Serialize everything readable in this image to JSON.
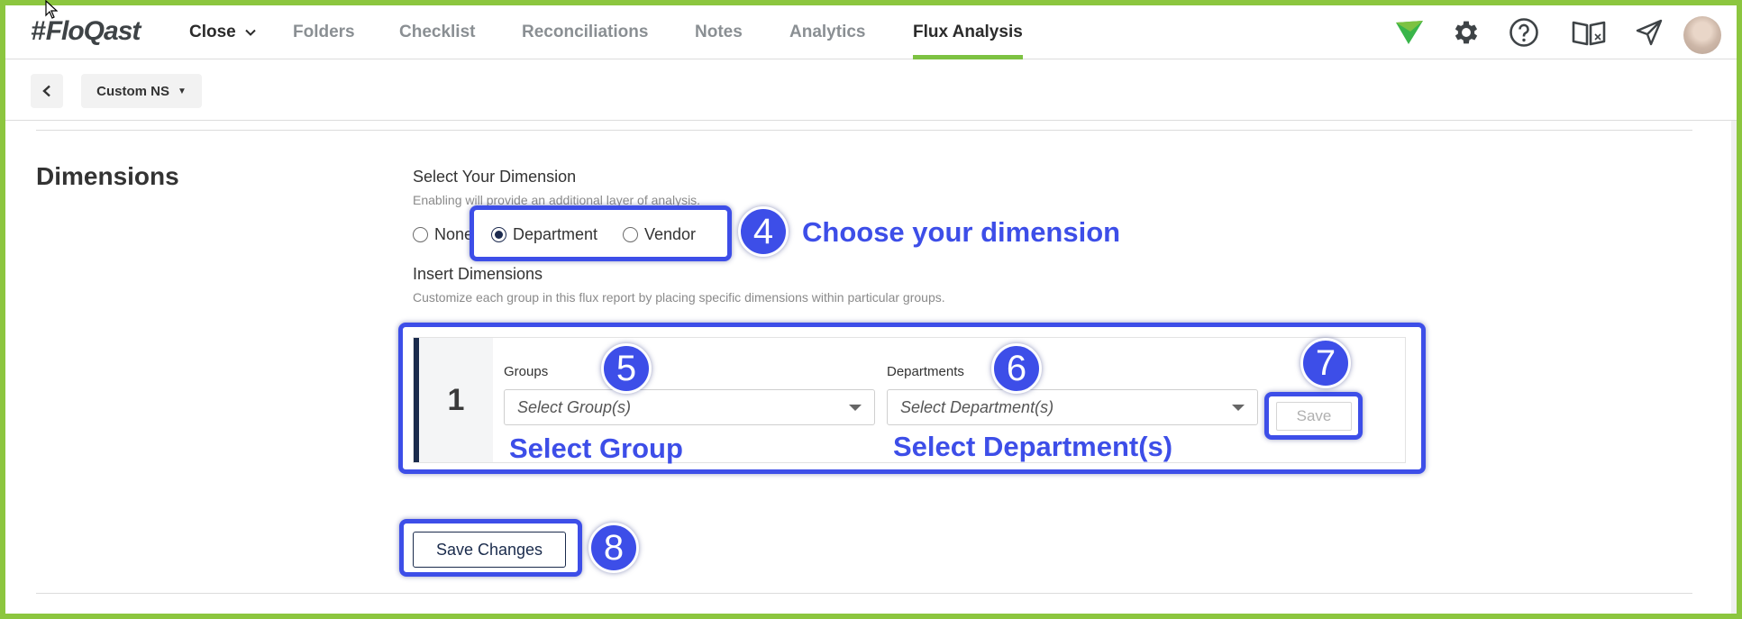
{
  "app": {
    "logo_hash": "#",
    "logo_text": "FloQast"
  },
  "nav": {
    "tabs": [
      {
        "label": "Close"
      },
      {
        "label": "Folders"
      },
      {
        "label": "Checklist"
      },
      {
        "label": "Reconciliations"
      },
      {
        "label": "Notes"
      },
      {
        "label": "Analytics"
      },
      {
        "label": "Flux Analysis"
      }
    ],
    "active_tab": "Flux Analysis",
    "accent_color": "#7dc242",
    "icons": [
      "floqast-flag-icon",
      "gear-icon",
      "help-icon",
      "book-icon",
      "send-icon",
      "avatar"
    ]
  },
  "subbar": {
    "entity_label": "Custom NS"
  },
  "dimensions": {
    "title": "Dimensions",
    "select_heading": "Select Your Dimension",
    "select_hint": "Enabling will provide an additional layer of analysis.",
    "options": [
      {
        "label": "None",
        "checked": false
      },
      {
        "label": "Department",
        "checked": true
      },
      {
        "label": "Vendor",
        "checked": false
      }
    ],
    "insert_heading": "Insert Dimensions",
    "insert_hint": "Customize each group in this flux report by placing specific dimensions within particular groups.",
    "group": {
      "number": "1",
      "groups_label": "Groups",
      "groups_placeholder": "Select Group(s)",
      "departments_label": "Departments",
      "departments_placeholder": "Select Department(s)",
      "save_label": "Save"
    },
    "save_changes_label": "Save Changes"
  },
  "tutorial": {
    "highlight_color": "#3d4ee8",
    "steps": [
      {
        "number": "4",
        "caption": "Choose your dimension"
      },
      {
        "number": "5",
        "caption": "Select Group"
      },
      {
        "number": "6",
        "caption": "Select Department(s)"
      },
      {
        "number": "7",
        "caption": ""
      },
      {
        "number": "8",
        "caption": ""
      }
    ]
  }
}
